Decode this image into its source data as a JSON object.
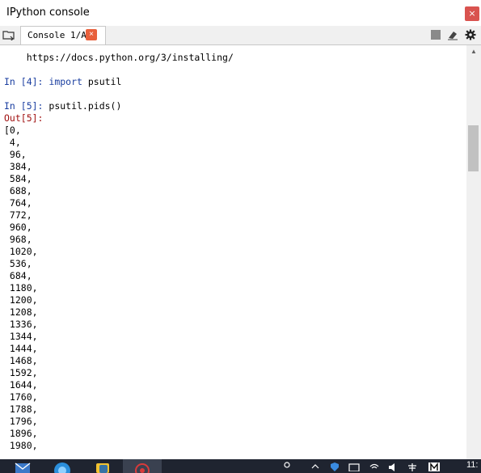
{
  "window": {
    "title": "IPython console",
    "close_glyph": "×"
  },
  "tabs": [
    {
      "label": "Console 1/A",
      "close_glyph": "×"
    }
  ],
  "toolbar": {
    "icons": [
      "stop-icon",
      "clear-icon",
      "gear-icon"
    ]
  },
  "console": {
    "url_line": "    https://docs.python.org/3/installing/",
    "in4_prompt": "In [4]:",
    "in4_keyword": "import",
    "in4_code": " psutil",
    "in5_prompt": "In [5]:",
    "in5_code": " psutil.pids()",
    "out5_prompt": "Out[5]:",
    "output_lines": [
      "[0,",
      " 4,",
      " 96,",
      " 384,",
      " 584,",
      " 688,",
      " 764,",
      " 772,",
      " 960,",
      " 968,",
      " 1020,",
      " 536,",
      " 684,",
      " 1180,",
      " 1200,",
      " 1208,",
      " 1336,",
      " 1344,",
      " 1444,",
      " 1468,",
      " 1592,",
      " 1644,",
      " 1760,",
      " 1788,",
      " 1796,",
      " 1896,",
      " 1980,"
    ]
  },
  "taskbar": {
    "clock": "11:"
  },
  "colors": {
    "prompt_in": "#1a3ea0",
    "prompt_out": "#a01010",
    "taskbar": "#1f2430"
  }
}
